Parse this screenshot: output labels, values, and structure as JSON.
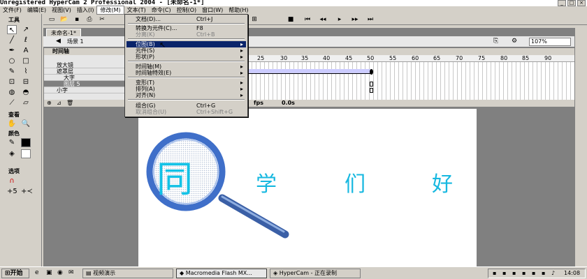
{
  "window": {
    "title": "Unregistered HyperCam 2 Professional 2004 - [未命名-1*]"
  },
  "menubar": [
    "文件(F)",
    "编辑(E)",
    "视图(V)",
    "插入(I)",
    "修改(M)",
    "文本(T)",
    "命令(C)",
    "控制(O)",
    "窗口(W)",
    "帮助(H)"
  ],
  "tools": {
    "title": "工具",
    "view_label": "查看",
    "color_label": "颜色",
    "options_label": "选项"
  },
  "document": {
    "tab": "未命名-1*",
    "scene": "场景 1",
    "zoom": "107%"
  },
  "timeline": {
    "title": "时间轴",
    "ruler": [
      "25",
      "30",
      "35",
      "40",
      "45",
      "50",
      "55",
      "60",
      "65",
      "70",
      "75",
      "80",
      "85",
      "90"
    ],
    "layers": [
      "放大镜",
      "遮罩层",
      "大字",
      "图层 5",
      "小字"
    ],
    "fps_label": "fps",
    "time": "0.0s"
  },
  "stage": {
    "big_char": "同",
    "small_chars": [
      "学",
      "们",
      "好"
    ]
  },
  "menu": {
    "items": [
      {
        "label": "文档(D)...",
        "shortcut": "Ctrl+J"
      },
      {
        "label": "转换为元件(C)...",
        "shortcut": "F8"
      },
      {
        "label": "分离(K)",
        "shortcut": "Ctrl+B"
      },
      {
        "label": "位图(B)"
      },
      {
        "label": "元件(S)"
      },
      {
        "label": "形状(P)"
      },
      {
        "label": "时间轴(M)"
      },
      {
        "label": "时间轴特效(E)"
      },
      {
        "label": "变形(T)"
      },
      {
        "label": "排列(A)"
      },
      {
        "label": "对齐(N)"
      },
      {
        "label": "组合(G)",
        "shortcut": "Ctrl+G"
      },
      {
        "label": "取消组合(U)",
        "shortcut": "Ctrl+Shift+G"
      }
    ]
  },
  "taskbar": {
    "start": "开始",
    "tasks": [
      "视频演示",
      "Macromedia Flash MX...",
      "HyperCam - 正在录制"
    ],
    "clock": "14:08"
  }
}
